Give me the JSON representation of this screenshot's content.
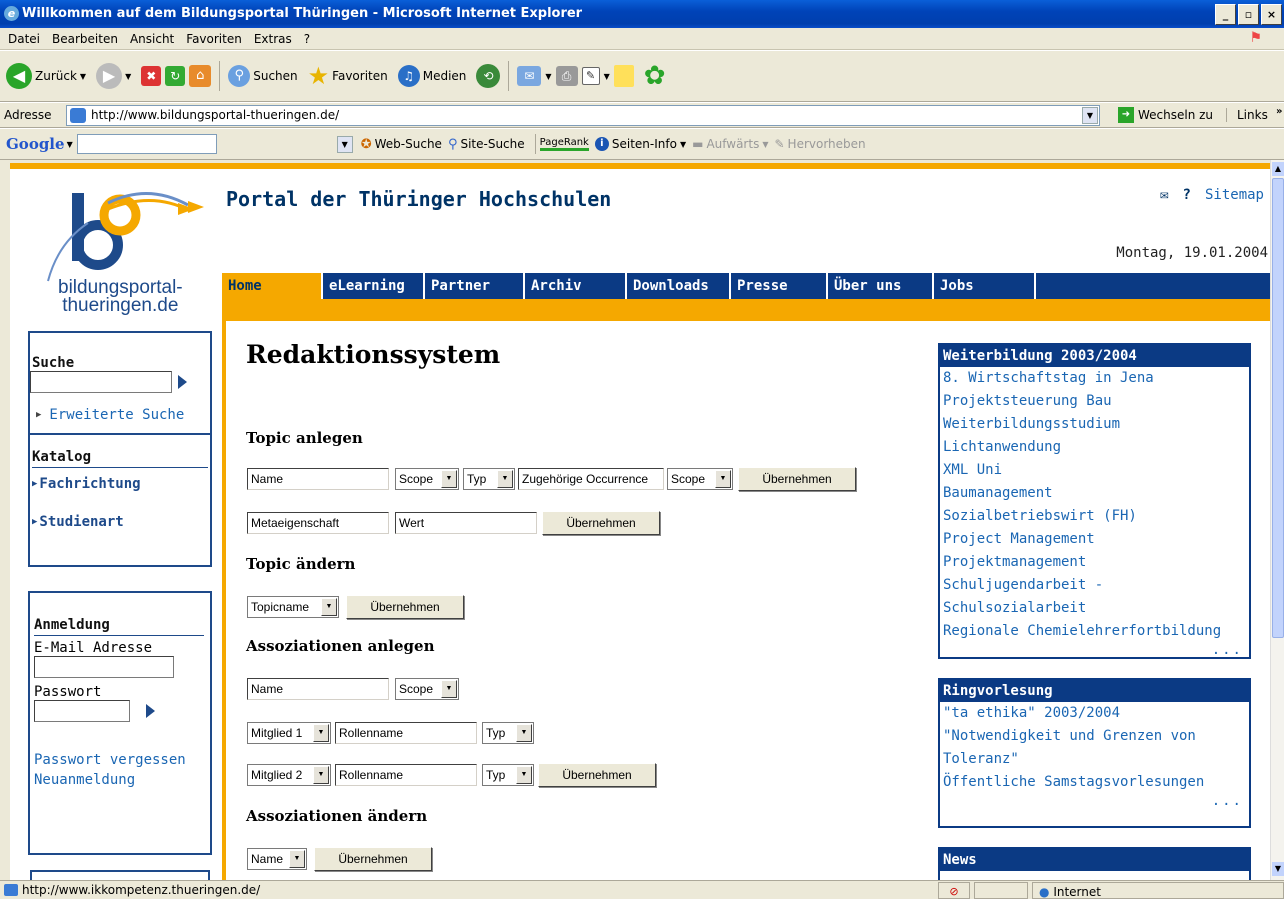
{
  "window": {
    "title": "Willkommen auf dem Bildungsportal Thüringen - Microsoft Internet Explorer"
  },
  "menu": [
    "Datei",
    "Bearbeiten",
    "Ansicht",
    "Favoriten",
    "Extras",
    "?"
  ],
  "toolbar": {
    "back": "Zurück",
    "search": "Suchen",
    "favorites": "Favoriten",
    "media": "Medien"
  },
  "address": {
    "label": "Adresse",
    "url": "http://www.bildungsportal-thueringen.de/",
    "go": "Wechseln zu",
    "links": "Links"
  },
  "google": {
    "brand": "Google",
    "web_search": "Web-Suche",
    "site_search": "Site-Suche",
    "pagerank": "PageRank",
    "page_info": "Seiten-Info",
    "up": "Aufwärts",
    "highlight": "Hervorheben"
  },
  "site": {
    "logo_text_1": "bildungsportal-",
    "logo_text_2": "thueringen.de",
    "title": "Portal der Thüringer Hochschulen",
    "sitemap": "Sitemap",
    "date": "Montag, 19.01.2004",
    "nav": [
      "Home",
      "eLearning",
      "Partner",
      "Archiv",
      "Downloads",
      "Presse",
      "Über uns",
      "Jobs"
    ]
  },
  "sidebar": {
    "search_title": "Suche",
    "advanced_search": "Erweiterte Suche",
    "catalog_title": "Katalog",
    "catalog_items": [
      "Fachrichtung",
      "Studienart"
    ],
    "login_title": "Anmeldung",
    "email_label": "E-Mail Adresse",
    "password_label": "Passwort",
    "forgot": "Passwort vergessen",
    "register": "Neuanmeldung"
  },
  "main": {
    "title": "Redaktionssystem",
    "topic_create": "Topic anlegen",
    "topic_change": "Topic ändern",
    "assoc_create": "Assoziationen anlegen",
    "assoc_change": "Assoziationen ändern",
    "name": "Name",
    "scope": "Scope",
    "type": "Typ",
    "occurrence": "Zugehörige Occurrence",
    "submit": "Übernehmen",
    "meta": "Metaeigenschaft",
    "value": "Wert",
    "topicname": "Topicname",
    "member1": "Mitglied 1",
    "member2": "Mitglied 2",
    "rolename": "Rollenname"
  },
  "weiterbildung": {
    "title": "Weiterbildung 2003/2004",
    "items": [
      "8. Wirtschaftstag in Jena",
      "Projektsteuerung Bau",
      "Weiterbildungsstudium",
      "Lichtanwendung",
      "XML Uni",
      "Baumanagement",
      "Sozialbetriebswirt (FH)",
      "Project Management",
      "Projektmanagement",
      "Schuljugendarbeit - Schulsozialarbeit",
      "Regionale Chemielehrerfortbildung"
    ],
    "more": "..."
  },
  "ringvorlesung": {
    "title": "Ringvorlesung",
    "items": [
      "\"ta ethika\" 2003/2004",
      "\"Notwendigkeit und Grenzen von",
      "Toleranz\"",
      "Öffentliche Samstagsvorlesungen"
    ],
    "more": "..."
  },
  "news": {
    "title": "News"
  },
  "status": {
    "url": "http://www.ikkompetenz.thueringen.de/",
    "zone": "Internet"
  }
}
